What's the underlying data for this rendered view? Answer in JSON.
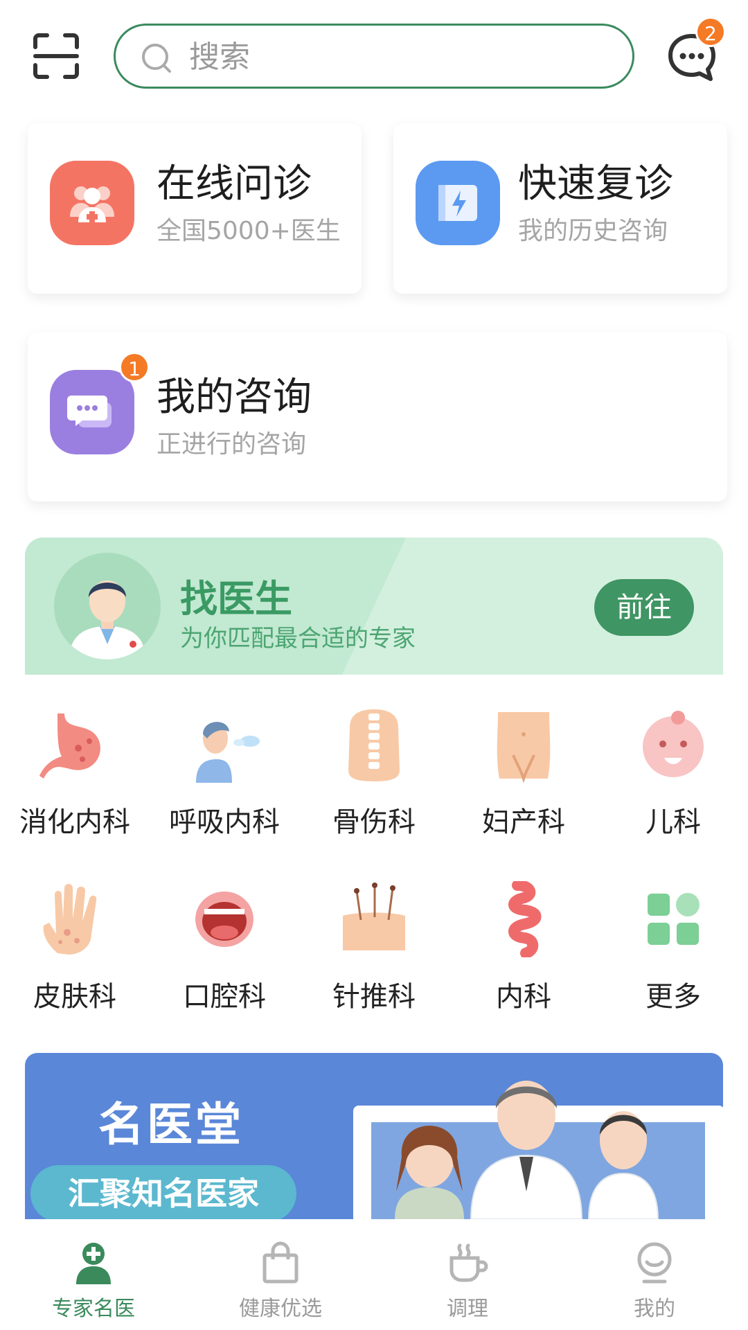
{
  "header": {
    "search_placeholder": "搜索",
    "message_badge": "2"
  },
  "quick_actions": [
    {
      "title": "在线问诊",
      "subtitle": "全国5000+医生",
      "icon": "doctors-icon",
      "color": "#f47464"
    },
    {
      "title": "快速复诊",
      "subtitle": "我的历史咨询",
      "icon": "lightning-icon",
      "color": "#5b9af0"
    },
    {
      "title": "我的咨询",
      "subtitle": "正进行的咨询",
      "icon": "chat-bubble-icon",
      "color": "#9a7fe0",
      "badge": "1"
    }
  ],
  "find_doctor": {
    "title": "找医生",
    "subtitle": "为你匹配最合适的专家",
    "button": "前往"
  },
  "departments": [
    {
      "label": "消化内科",
      "icon": "stomach-icon"
    },
    {
      "label": "呼吸内科",
      "icon": "breathing-icon"
    },
    {
      "label": "骨伤科",
      "icon": "spine-icon"
    },
    {
      "label": "妇产科",
      "icon": "pelvis-icon"
    },
    {
      "label": "儿科",
      "icon": "baby-icon"
    },
    {
      "label": "皮肤科",
      "icon": "hand-icon"
    },
    {
      "label": "口腔科",
      "icon": "mouth-icon"
    },
    {
      "label": "针推科",
      "icon": "acupuncture-icon"
    },
    {
      "label": "内科",
      "icon": "intestine-icon"
    },
    {
      "label": "更多",
      "icon": "grid-more-icon"
    }
  ],
  "promo": {
    "title": "名医堂",
    "pill": "汇聚知名医家"
  },
  "bottom_nav": [
    {
      "label": "专家名医",
      "icon": "doctor-cross-icon",
      "active": true
    },
    {
      "label": "健康优选",
      "icon": "shopping-bag-icon",
      "active": false
    },
    {
      "label": "调理",
      "icon": "tea-cup-icon",
      "active": false
    },
    {
      "label": "我的",
      "icon": "profile-icon",
      "active": false
    }
  ],
  "colors": {
    "brand_green": "#3b8a5f",
    "badge_orange": "#f47a25",
    "banner_blue": "#5a87d8"
  }
}
